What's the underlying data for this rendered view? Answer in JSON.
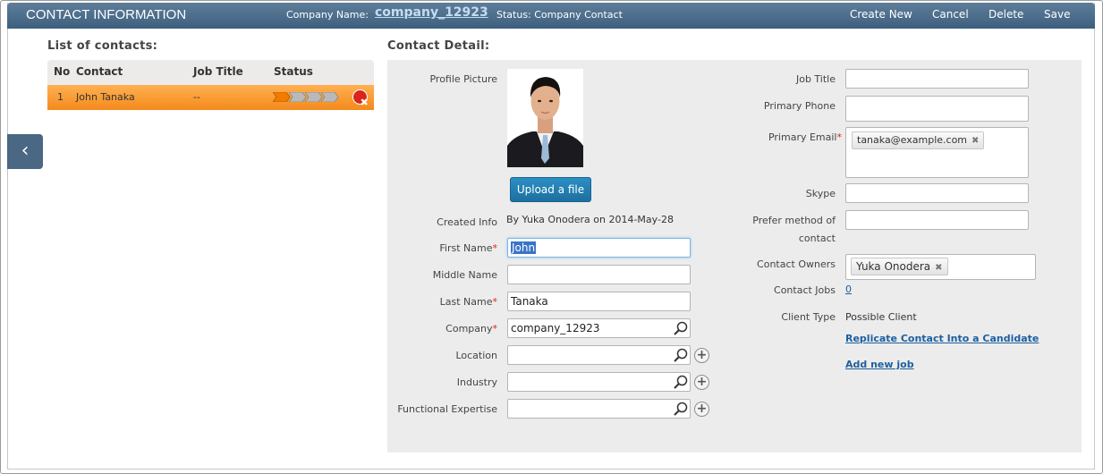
{
  "header": {
    "title": "CONTACT INFORMATION",
    "company_label": "Company Name:",
    "company_value": "company_12923",
    "status": "Status: Company Contact",
    "actions": {
      "create": "Create New",
      "cancel": "Cancel",
      "delete": "Delete",
      "save": "Save"
    }
  },
  "contacts": {
    "title": "List of contacts:",
    "columns": [
      "No",
      "Contact",
      "Job Title",
      "Status"
    ],
    "rows": [
      {
        "no": "1",
        "contact": "John Tanaka",
        "job_title": "--",
        "status_steps": 4,
        "status_complete": 1
      }
    ]
  },
  "detail": {
    "title": "Contact Detail:",
    "profile_picture_label": "Profile Picture",
    "upload_label": "Upload a file",
    "created_info_label": "Created Info",
    "created_info_value": "By Yuka Onodera on 2014-May-28",
    "first_name_label": "First Name",
    "first_name_value": "John",
    "middle_name_label": "Middle Name",
    "middle_name_value": "",
    "last_name_label": "Last Name",
    "last_name_value": "Tanaka",
    "company_label": "Company",
    "company_value": "company_12923",
    "location_label": "Location",
    "industry_label": "Industry",
    "functional_expertise_label": "Functional Expertise",
    "job_title_label": "Job Title",
    "primary_phone_label": "Primary Phone",
    "primary_email_label": "Primary Email",
    "primary_email_tag": "tanaka@example.com",
    "skype_label": "Skype",
    "prefer_method_label_1": "Prefer method of",
    "prefer_method_label_2": "contact",
    "contact_owners_label": "Contact Owners",
    "contact_owner_tag": "Yuka Onodera",
    "contact_jobs_label": "Contact Jobs",
    "contact_jobs_value": "0",
    "client_type_label": "Client Type",
    "client_type_value": "Possible Client",
    "replicate_link": "Replicate Contact Into a Candidate",
    "add_job_link": "Add new job",
    "required_mark": "*"
  },
  "colors": {
    "header": "#3d5f7e",
    "selected_row": "#f48a1c",
    "upload_button": "#1d6fa0",
    "link": "#1d5fa0",
    "required": "#d9251b"
  },
  "icons": {
    "back": "chevron-left-icon",
    "delete_row": "close-circle-icon",
    "lookup": "magnifier-icon",
    "add": "plus-circle-icon",
    "remove_tag": "x-icon"
  }
}
